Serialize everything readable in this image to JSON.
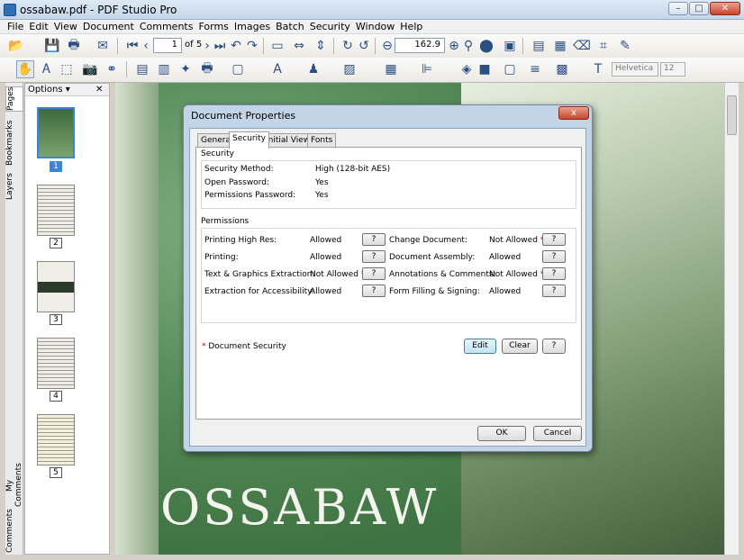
{
  "app": {
    "title": "ossabaw.pdf - PDF Studio Pro"
  },
  "menu": [
    "File",
    "Edit",
    "View",
    "Document",
    "Comments",
    "Forms",
    "Images",
    "Batch",
    "Security",
    "Window",
    "Help"
  ],
  "toolbar": {
    "page_current": "1",
    "page_total": "of 5",
    "zoom": "162.9",
    "font": "Helvetica",
    "font_size": "12"
  },
  "sidebar": {
    "tabs": [
      "Pages",
      "Bookmarks",
      "Layers",
      "My Comments",
      "Comments"
    ]
  },
  "thumbnails": {
    "header": "Options",
    "pages": [
      "1",
      "2",
      "3",
      "4",
      "5"
    ]
  },
  "document": {
    "cover_text": "OSSABAW"
  },
  "dialog": {
    "title": "Document Properties",
    "close": "x",
    "tabs": [
      "General",
      "Security",
      "Initial View",
      "Fonts"
    ],
    "security_group": "Security",
    "security": [
      {
        "label": "Security Method:",
        "value": "High (128-bit AES)"
      },
      {
        "label": "Open Password:",
        "value": "Yes"
      },
      {
        "label": "Permissions Password:",
        "value": "Yes"
      }
    ],
    "permissions_group": "Permissions",
    "permissions_left": [
      {
        "label": "Printing High Res:",
        "value": "Allowed",
        "starred": false
      },
      {
        "label": "Printing:",
        "value": "Allowed",
        "starred": false
      },
      {
        "label": "Text & Graphics Extraction:",
        "value": "Not Allowed",
        "starred": true
      },
      {
        "label": "Extraction for Accessibility:",
        "value": "Allowed",
        "starred": false
      }
    ],
    "permissions_right": [
      {
        "label": "Change Document:",
        "value": "Not Allowed",
        "starred": true
      },
      {
        "label": "Document Assembly:",
        "value": "Allowed",
        "starred": false
      },
      {
        "label": "Annotations & Comments:",
        "value": "Not Allowed",
        "starred": true
      },
      {
        "label": "Form Filling & Signing:",
        "value": "Allowed",
        "starred": false
      }
    ],
    "help_label": "?",
    "star": "*",
    "doc_security": "Document Security",
    "edit": "Edit",
    "clear": "Clear",
    "ok": "OK",
    "cancel": "Cancel"
  }
}
